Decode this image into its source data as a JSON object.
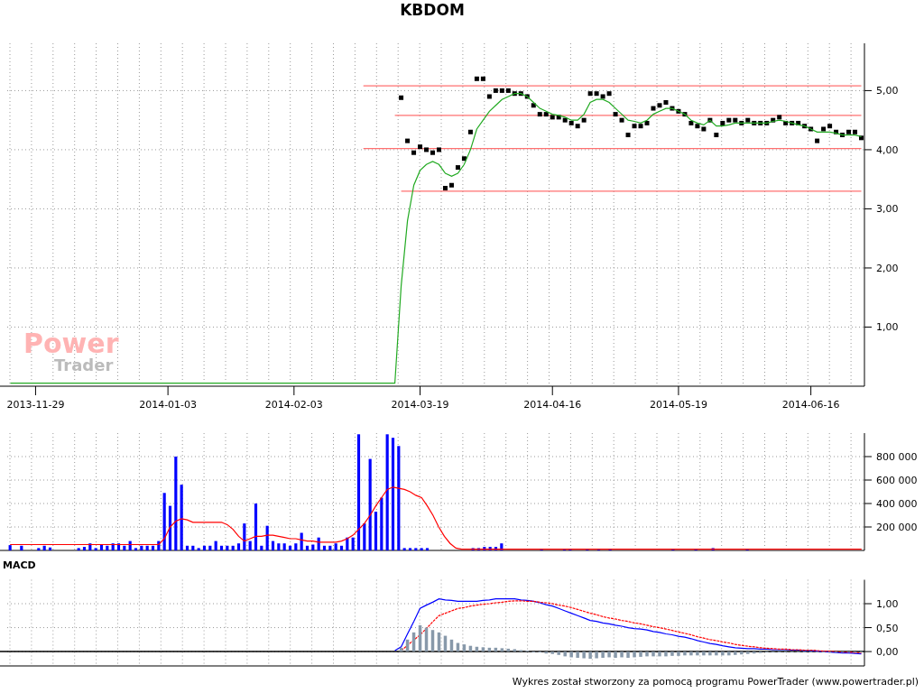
{
  "title": "KBDOM",
  "watermark_logo": {
    "line1": "Power",
    "line2": "Trader"
  },
  "price_chart": {
    "chart_data": {
      "type": "line",
      "grid": true,
      "ylim": [
        0,
        5.8
      ],
      "categories": [
        null,
        null,
        null,
        null,
        "2013-11-29",
        null,
        null,
        null,
        null,
        null,
        null,
        null,
        null,
        null,
        null,
        null,
        null,
        null,
        null,
        null,
        null,
        null,
        null,
        null,
        null,
        "2014-01-03",
        null,
        null,
        null,
        null,
        null,
        null,
        null,
        null,
        null,
        null,
        null,
        null,
        null,
        null,
        null,
        null,
        null,
        null,
        null,
        "2014-02-03",
        null,
        null,
        null,
        null,
        null,
        null,
        null,
        null,
        null,
        null,
        null,
        null,
        null,
        null,
        null,
        null,
        null,
        null,
        null,
        "2014-03-19",
        null,
        null,
        null,
        null,
        null,
        null,
        null,
        null,
        null,
        null,
        null,
        null,
        null,
        null,
        null,
        null,
        null,
        null,
        null,
        null,
        "2014-04-16",
        null,
        null,
        null,
        null,
        null,
        null,
        null,
        null,
        null,
        null,
        null,
        null,
        null,
        null,
        null,
        null,
        null,
        null,
        null,
        "2014-05-19",
        null,
        null,
        null,
        null,
        null,
        null,
        null,
        null,
        null,
        null,
        null,
        null,
        null,
        null,
        null,
        null,
        null,
        null,
        null,
        null,
        "2014-06-16",
        null,
        null,
        null,
        null,
        null,
        null,
        null,
        null
      ],
      "yticks": [
        {
          "value": 1,
          "label": "1,00"
        },
        {
          "value": 2,
          "label": "2,00"
        },
        {
          "value": 3,
          "label": "3,00"
        },
        {
          "value": 4,
          "label": "4,00"
        },
        {
          "value": 5,
          "label": "5,00"
        }
      ],
      "series": [
        {
          "color": "#ff7070",
          "values": [
            null,
            null,
            null,
            null,
            null,
            null,
            null,
            null,
            null,
            null,
            null,
            null,
            null,
            null,
            null,
            null,
            null,
            null,
            null,
            null,
            null,
            null,
            null,
            null,
            null,
            null,
            null,
            null,
            null,
            null,
            null,
            null,
            null,
            null,
            null,
            null,
            null,
            null,
            null,
            null,
            null,
            null,
            null,
            null,
            null,
            null,
            null,
            null,
            null,
            null,
            null,
            null,
            null,
            null,
            null,
            null,
            5.08,
            5.08,
            5.08,
            5.08,
            5.08,
            5.08,
            5.08,
            5.08,
            5.08,
            5.08,
            5.08,
            5.08,
            5.08,
            5.08,
            5.08,
            5.08,
            5.08,
            5.08,
            5.08,
            5.08,
            5.08,
            5.08,
            5.08,
            5.08,
            5.08,
            5.08,
            5.08,
            5.08,
            5.08,
            5.08,
            5.08,
            5.08,
            5.08,
            5.08,
            5.08,
            5.08,
            5.08,
            5.08,
            5.08,
            5.08,
            5.08,
            5.08,
            5.08,
            5.08,
            5.08,
            5.08,
            5.08,
            5.08,
            5.08,
            5.08,
            5.08,
            5.08,
            5.08,
            5.08,
            5.08,
            5.08,
            5.08,
            5.08,
            5.08,
            5.08,
            5.08,
            5.08,
            5.08,
            5.08,
            5.08,
            5.08,
            5.08,
            5.08,
            5.08,
            5.08,
            5.08,
            5.08,
            5.08,
            5.08,
            5.08,
            5.08,
            5.08,
            5.08,
            5.08,
            5.08
          ]
        },
        {
          "color": "#ff7070",
          "values": [
            null,
            null,
            null,
            null,
            null,
            null,
            null,
            null,
            null,
            null,
            null,
            null,
            null,
            null,
            null,
            null,
            null,
            null,
            null,
            null,
            null,
            null,
            null,
            null,
            null,
            null,
            null,
            null,
            null,
            null,
            null,
            null,
            null,
            null,
            null,
            null,
            null,
            null,
            null,
            null,
            null,
            null,
            null,
            null,
            null,
            null,
            null,
            null,
            null,
            null,
            null,
            null,
            null,
            null,
            null,
            null,
            null,
            null,
            null,
            null,
            null,
            4.58,
            4.58,
            4.58,
            4.58,
            4.58,
            4.58,
            4.58,
            4.58,
            4.58,
            4.58,
            4.58,
            4.58,
            4.58,
            4.58,
            4.58,
            4.58,
            4.58,
            4.58,
            4.58,
            4.58,
            4.58,
            4.58,
            4.58,
            4.58,
            4.58,
            4.58,
            4.58,
            4.58,
            4.58,
            4.58,
            4.58,
            4.58,
            4.58,
            4.58,
            4.58,
            4.58,
            4.58,
            4.58,
            4.58,
            4.58,
            4.58,
            4.58,
            4.58,
            4.58,
            4.58,
            4.58,
            4.58,
            4.58,
            4.58,
            4.58,
            4.58,
            4.58,
            4.58,
            4.58,
            4.58,
            4.58,
            4.58,
            4.58,
            4.58,
            4.58,
            4.58,
            4.58,
            4.58,
            4.58,
            4.58,
            4.58,
            4.58,
            4.58,
            4.58,
            4.58,
            4.58,
            4.58,
            4.58,
            4.58,
            4.58
          ]
        },
        {
          "color": "#ff7070",
          "values": [
            null,
            null,
            null,
            null,
            null,
            null,
            null,
            null,
            null,
            null,
            null,
            null,
            null,
            null,
            null,
            null,
            null,
            null,
            null,
            null,
            null,
            null,
            null,
            null,
            null,
            null,
            null,
            null,
            null,
            null,
            null,
            null,
            null,
            null,
            null,
            null,
            null,
            null,
            null,
            null,
            null,
            null,
            null,
            null,
            null,
            null,
            null,
            null,
            null,
            null,
            null,
            null,
            null,
            null,
            null,
            null,
            4.02,
            4.02,
            4.02,
            4.02,
            4.02,
            4.02,
            4.02,
            4.02,
            4.02,
            4.02,
            4.02,
            4.02,
            4.02,
            4.02,
            4.02,
            4.02,
            4.02,
            4.02,
            4.02,
            4.02,
            4.02,
            4.02,
            4.02,
            4.02,
            4.02,
            4.02,
            4.02,
            4.02,
            4.02,
            4.02,
            4.02,
            4.02,
            4.02,
            4.02,
            4.02,
            4.02,
            4.02,
            4.02,
            4.02,
            4.02,
            4.02,
            4.02,
            4.02,
            4.02,
            4.02,
            4.02,
            4.02,
            4.02,
            4.02,
            4.02,
            4.02,
            4.02,
            4.02,
            4.02,
            4.02,
            4.02,
            4.02,
            4.02,
            4.02,
            4.02,
            4.02,
            4.02,
            4.02,
            4.02,
            4.02,
            4.02,
            4.02,
            4.02,
            4.02,
            4.02,
            4.02,
            4.02,
            4.02,
            4.02,
            4.02,
            4.02,
            4.02,
            4.02,
            4.02,
            4.02
          ]
        },
        {
          "color": "#ff7070",
          "values": [
            null,
            null,
            null,
            null,
            null,
            null,
            null,
            null,
            null,
            null,
            null,
            null,
            null,
            null,
            null,
            null,
            null,
            null,
            null,
            null,
            null,
            null,
            null,
            null,
            null,
            null,
            null,
            null,
            null,
            null,
            null,
            null,
            null,
            null,
            null,
            null,
            null,
            null,
            null,
            null,
            null,
            null,
            null,
            null,
            null,
            null,
            null,
            null,
            null,
            null,
            null,
            null,
            null,
            null,
            null,
            null,
            null,
            null,
            null,
            null,
            null,
            null,
            3.3,
            3.3,
            3.3,
            3.3,
            3.3,
            3.3,
            3.3,
            3.3,
            3.3,
            3.3,
            3.3,
            3.3,
            3.3,
            3.3,
            3.3,
            3.3,
            3.3,
            3.3,
            3.3,
            3.3,
            3.3,
            3.3,
            3.3,
            3.3,
            3.3,
            3.3,
            3.3,
            3.3,
            3.3,
            3.3,
            3.3,
            3.3,
            3.3,
            3.3,
            3.3,
            3.3,
            3.3,
            3.3,
            3.3,
            3.3,
            3.3,
            3.3,
            3.3,
            3.3,
            3.3,
            3.3,
            3.3,
            3.3,
            3.3,
            3.3,
            3.3,
            3.3,
            3.3,
            3.3,
            3.3,
            3.3,
            3.3,
            3.3,
            3.3,
            3.3,
            3.3,
            3.3,
            3.3,
            3.3,
            3.3,
            3.3,
            3.3,
            3.3,
            3.3,
            3.3,
            3.3,
            3.3,
            3.3,
            3.3
          ]
        },
        {
          "type": "scatter",
          "color": "#000000",
          "values": [
            null,
            null,
            null,
            null,
            null,
            null,
            null,
            null,
            null,
            null,
            null,
            null,
            null,
            null,
            null,
            null,
            null,
            null,
            null,
            null,
            null,
            null,
            null,
            null,
            null,
            null,
            null,
            null,
            null,
            null,
            null,
            null,
            null,
            null,
            null,
            null,
            null,
            null,
            null,
            null,
            null,
            null,
            null,
            null,
            null,
            null,
            null,
            null,
            null,
            null,
            null,
            null,
            null,
            null,
            null,
            null,
            null,
            null,
            null,
            null,
            null,
            null,
            4.88,
            4.15,
            3.95,
            4.05,
            4.0,
            3.95,
            4.0,
            3.35,
            3.4,
            3.7,
            3.85,
            4.3,
            5.2,
            5.2,
            4.9,
            5.0,
            5.0,
            5.0,
            4.95,
            4.95,
            4.9,
            4.75,
            4.6,
            4.6,
            4.55,
            4.55,
            4.5,
            4.45,
            4.4,
            4.5,
            4.95,
            4.95,
            4.9,
            4.95,
            4.6,
            4.5,
            4.25,
            4.4,
            4.4,
            4.45,
            4.7,
            4.75,
            4.8,
            4.7,
            4.65,
            4.6,
            4.45,
            4.4,
            4.35,
            4.5,
            4.25,
            4.45,
            4.5,
            4.5,
            4.45,
            4.5,
            4.45,
            4.45,
            4.45,
            4.5,
            4.55,
            4.45,
            4.45,
            4.45,
            4.4,
            4.35,
            4.15,
            4.35,
            4.4,
            4.3,
            4.25,
            4.3,
            4.3,
            4.2
          ]
        },
        {
          "color": "#22aa22",
          "values": [
            0.05,
            0.05,
            0.05,
            0.05,
            0.05,
            0.05,
            0.05,
            0.05,
            0.05,
            0.05,
            0.05,
            0.05,
            0.05,
            0.05,
            0.05,
            0.05,
            0.05,
            0.05,
            0.05,
            0.05,
            0.05,
            0.05,
            0.05,
            0.05,
            0.05,
            0.05,
            0.05,
            0.05,
            0.05,
            0.05,
            0.05,
            0.05,
            0.05,
            0.05,
            0.05,
            0.05,
            0.05,
            0.05,
            0.05,
            0.05,
            0.05,
            0.05,
            0.05,
            0.05,
            0.05,
            0.05,
            0.05,
            0.05,
            0.05,
            0.05,
            0.05,
            0.05,
            0.05,
            0.05,
            0.05,
            0.05,
            0.05,
            0.05,
            0.05,
            0.05,
            0.05,
            0.05,
            1.7,
            2.8,
            3.4,
            3.65,
            3.75,
            3.8,
            3.75,
            3.6,
            3.55,
            3.6,
            3.75,
            4.0,
            4.35,
            4.5,
            4.65,
            4.75,
            4.85,
            4.9,
            4.95,
            4.95,
            4.9,
            4.8,
            4.7,
            4.65,
            4.6,
            4.58,
            4.55,
            4.5,
            4.5,
            4.6,
            4.8,
            4.85,
            4.85,
            4.8,
            4.7,
            4.6,
            4.5,
            4.48,
            4.45,
            4.5,
            4.6,
            4.65,
            4.7,
            4.7,
            4.65,
            4.6,
            4.5,
            4.45,
            4.42,
            4.5,
            4.4,
            4.4,
            4.42,
            4.45,
            4.45,
            4.45,
            4.45,
            4.45,
            4.45,
            4.48,
            4.5,
            4.48,
            4.45,
            4.42,
            4.4,
            4.35,
            4.3,
            4.3,
            4.3,
            4.28,
            4.25,
            4.25,
            4.25,
            4.22
          ]
        }
      ]
    }
  },
  "volume_chart": {
    "chart_data": {
      "type": "bar",
      "grid": true,
      "stacked": false,
      "ylim": [
        0,
        1000000
      ],
      "categories": [
        null,
        null,
        null,
        null,
        null,
        null,
        null,
        null,
        null,
        null,
        null,
        null,
        null,
        null,
        null,
        null,
        null,
        null,
        null,
        null,
        null,
        null,
        null,
        null,
        null,
        null,
        null,
        null,
        null,
        null,
        null,
        null,
        null,
        null,
        null,
        null,
        null,
        null,
        null,
        null,
        null,
        null,
        null,
        null,
        null,
        null,
        null,
        null,
        null,
        null,
        null,
        null,
        null,
        null,
        null,
        null,
        null,
        null,
        null,
        null,
        null,
        null,
        null,
        null,
        null,
        null,
        null,
        null,
        null,
        null,
        null,
        null,
        null,
        null,
        null,
        null,
        null,
        null,
        null,
        null,
        null,
        null,
        null,
        null,
        null,
        null,
        null,
        null,
        null,
        null,
        null,
        null,
        null,
        null,
        null,
        null,
        null,
        null,
        null,
        null,
        null,
        null,
        null,
        null,
        null,
        null,
        null,
        null,
        null,
        null,
        null,
        null,
        null,
        null,
        null,
        null,
        null,
        null,
        null,
        null,
        null,
        null,
        null,
        null,
        null,
        null,
        null,
        null,
        null,
        null,
        null,
        null,
        null,
        null,
        null,
        null,
        null,
        null,
        null,
        null,
        null,
        null,
        null,
        null,
        null,
        null,
        null,
        null,
        null,
        null
      ],
      "yticks": [
        {
          "value": 200000,
          "label": "200 000"
        },
        {
          "value": 400000,
          "label": "400 000"
        },
        {
          "value": 600000,
          "label": "600 000"
        },
        {
          "value": 800000,
          "label": "800 000"
        }
      ],
      "series": [
        {
          "color": "#0000ff",
          "values": [
            45000,
            null,
            40000,
            null,
            null,
            20000,
            40000,
            25000,
            null,
            null,
            null,
            null,
            20000,
            30000,
            60000,
            20000,
            50000,
            40000,
            60000,
            60000,
            40000,
            80000,
            20000,
            40000,
            40000,
            40000,
            80000,
            490000,
            380000,
            800000,
            560000,
            40000,
            40000,
            20000,
            40000,
            40000,
            80000,
            40000,
            40000,
            40000,
            60000,
            230000,
            80000,
            400000,
            40000,
            210000,
            80000,
            60000,
            60000,
            40000,
            60000,
            150000,
            40000,
            50000,
            110000,
            40000,
            40000,
            60000,
            40000,
            110000,
            110000,
            990000,
            230000,
            780000,
            330000,
            450000,
            990000,
            960000,
            890000,
            20000,
            20000,
            20000,
            20000,
            20000,
            null,
            null,
            null,
            null,
            null,
            null,
            null,
            20000,
            20000,
            30000,
            30000,
            30000,
            60000,
            null,
            null,
            null,
            null,
            null,
            null,
            10000,
            null,
            null,
            null,
            10000,
            10000,
            null,
            null,
            10000,
            null,
            10000,
            null,
            10000,
            null,
            null,
            null,
            null,
            null,
            null,
            null,
            null,
            null,
            null,
            10000,
            null,
            null,
            null,
            10000,
            null,
            null,
            20000,
            null,
            null,
            null,
            null,
            null,
            10000,
            null,
            null,
            null,
            null,
            null,
            null,
            null,
            null,
            null,
            null,
            null,
            null,
            null,
            null,
            null,
            null,
            null,
            null,
            null,
            null
          ]
        },
        {
          "type": "line",
          "color": "#ff0000",
          "values": [
            50000,
            50000,
            50000,
            50000,
            50000,
            50000,
            50000,
            50000,
            50000,
            50000,
            50000,
            50000,
            50000,
            50000,
            50000,
            50000,
            50000,
            50000,
            50000,
            50000,
            50000,
            50000,
            50000,
            50000,
            50000,
            50000,
            50000,
            100000,
            200000,
            250000,
            270000,
            260000,
            240000,
            240000,
            240000,
            240000,
            240000,
            240000,
            220000,
            180000,
            120000,
            80000,
            100000,
            120000,
            120000,
            130000,
            130000,
            120000,
            110000,
            100000,
            100000,
            90000,
            80000,
            80000,
            70000,
            70000,
            70000,
            70000,
            80000,
            100000,
            130000,
            180000,
            230000,
            300000,
            380000,
            450000,
            520000,
            540000,
            530000,
            520000,
            500000,
            470000,
            450000,
            380000,
            300000,
            200000,
            120000,
            60000,
            20000,
            10000,
            10000,
            10000,
            10000,
            10000,
            10000,
            10000,
            10000,
            10000,
            10000,
            10000,
            10000,
            10000,
            10000,
            10000,
            10000,
            10000,
            10000,
            10000,
            10000,
            10000,
            10000,
            10000,
            10000,
            10000,
            10000,
            10000,
            10000,
            10000,
            10000,
            10000,
            10000,
            10000,
            10000,
            10000,
            10000,
            10000,
            10000,
            10000,
            10000,
            10000,
            10000,
            10000,
            10000,
            10000,
            10000,
            10000,
            10000,
            10000,
            10000,
            10000,
            10000,
            10000,
            10000,
            10000,
            10000,
            10000,
            10000,
            10000,
            10000,
            10000,
            10000,
            10000,
            10000,
            10000,
            10000,
            10000,
            10000,
            10000,
            10000,
            10000
          ]
        }
      ]
    }
  },
  "macd_chart": {
    "label": "MACD",
    "chart_data": {
      "type": "line",
      "grid": true,
      "ylim": [
        -0.3,
        1.5
      ],
      "categories": [
        null,
        null,
        null,
        null,
        null,
        null,
        null,
        null,
        null,
        null,
        null,
        null,
        null,
        null,
        null,
        null,
        null,
        null,
        null,
        null,
        null,
        null,
        null,
        null,
        null,
        null,
        null,
        null,
        null,
        null,
        null,
        null,
        null,
        null,
        null,
        null,
        null,
        null,
        null,
        null,
        null,
        null,
        null,
        null,
        null,
        null,
        null,
        null,
        null,
        null,
        null,
        null,
        null,
        null,
        null,
        null,
        null,
        null,
        null,
        null,
        null,
        null,
        null,
        null,
        null,
        null,
        null,
        null,
        null,
        null,
        null,
        null,
        null,
        null,
        null,
        null,
        null,
        null,
        null,
        null,
        null,
        null,
        null,
        null,
        null,
        null,
        null,
        null,
        null,
        null,
        null,
        null,
        null,
        null,
        null,
        null,
        null,
        null,
        null,
        null,
        null,
        null,
        null,
        null,
        null,
        null,
        null,
        null,
        null,
        null,
        null,
        null,
        null,
        null,
        null,
        null,
        null,
        null,
        null,
        null,
        null,
        null,
        null,
        null,
        null,
        null,
        null,
        null,
        null,
        null,
        null,
        null,
        null,
        null,
        null,
        null
      ],
      "yticks": [
        {
          "value": 0,
          "label": "0,00"
        },
        {
          "value": 0.5,
          "label": "0,50"
        },
        {
          "value": 1,
          "label": "1,00"
        }
      ],
      "series": [
        {
          "color": "#0000ff",
          "values": [
            null,
            null,
            null,
            null,
            null,
            null,
            null,
            null,
            null,
            null,
            null,
            null,
            null,
            null,
            null,
            null,
            null,
            null,
            null,
            null,
            null,
            null,
            null,
            null,
            null,
            null,
            null,
            null,
            null,
            null,
            null,
            null,
            null,
            null,
            null,
            null,
            null,
            null,
            null,
            null,
            null,
            null,
            null,
            null,
            null,
            null,
            null,
            null,
            null,
            null,
            null,
            null,
            null,
            null,
            null,
            null,
            null,
            null,
            null,
            null,
            null,
            0.02,
            0.1,
            0.37,
            0.63,
            0.9,
            0.97,
            1.03,
            1.1,
            1.08,
            1.07,
            1.05,
            1.05,
            1.05,
            1.05,
            1.07,
            1.08,
            1.1,
            1.1,
            1.1,
            1.1,
            1.08,
            1.07,
            1.05,
            1.02,
            0.98,
            0.95,
            0.9,
            0.85,
            0.8,
            0.75,
            0.7,
            0.65,
            0.63,
            0.6,
            0.58,
            0.55,
            0.53,
            0.5,
            0.48,
            0.47,
            0.45,
            0.42,
            0.4,
            0.37,
            0.35,
            0.32,
            0.3,
            0.27,
            0.23,
            0.2,
            0.17,
            0.15,
            0.12,
            0.1,
            0.08,
            0.07,
            0.06,
            0.06,
            0.05,
            0.05,
            0.04,
            0.04,
            0.04,
            0.03,
            0.03,
            0.02,
            0.02,
            0.01,
            0,
            -0.01,
            -0.02,
            -0.03,
            -0.03,
            -0.04,
            -0.05
          ]
        },
        {
          "color": "#ff0000",
          "line_style": "dashed",
          "values": [
            null,
            null,
            null,
            null,
            null,
            null,
            null,
            null,
            null,
            null,
            null,
            null,
            null,
            null,
            null,
            null,
            null,
            null,
            null,
            null,
            null,
            null,
            null,
            null,
            null,
            null,
            null,
            null,
            null,
            null,
            null,
            null,
            null,
            null,
            null,
            null,
            null,
            null,
            null,
            null,
            null,
            null,
            null,
            null,
            null,
            null,
            null,
            null,
            null,
            null,
            null,
            null,
            null,
            null,
            null,
            null,
            null,
            null,
            null,
            null,
            null,
            null,
            0.02,
            0.13,
            0.24,
            0.35,
            0.48,
            0.62,
            0.75,
            0.8,
            0.85,
            0.9,
            0.92,
            0.95,
            0.97,
            0.99,
            1.0,
            1.02,
            1.03,
            1.05,
            1.06,
            1.06,
            1.05,
            1.05,
            1.03,
            1.02,
            1.0,
            0.97,
            0.95,
            0.92,
            0.88,
            0.84,
            0.8,
            0.77,
            0.73,
            0.7,
            0.68,
            0.65,
            0.63,
            0.6,
            0.58,
            0.55,
            0.52,
            0.5,
            0.47,
            0.44,
            0.41,
            0.38,
            0.35,
            0.31,
            0.28,
            0.25,
            0.23,
            0.2,
            0.18,
            0.15,
            0.13,
            0.11,
            0.1,
            0.08,
            0.07,
            0.06,
            0.05,
            0.05,
            0.04,
            0.04,
            0.03,
            0.03,
            0.02,
            0.01,
            0.01,
            0,
            -0.01,
            -0.01,
            -0.02,
            -0.03
          ]
        },
        {
          "type": "bar",
          "color": "#8899aa",
          "values": [
            null,
            null,
            null,
            null,
            null,
            null,
            null,
            null,
            null,
            null,
            null,
            null,
            null,
            null,
            null,
            null,
            null,
            null,
            null,
            null,
            null,
            null,
            null,
            null,
            null,
            null,
            null,
            null,
            null,
            null,
            null,
            null,
            null,
            null,
            null,
            null,
            null,
            null,
            null,
            null,
            null,
            null,
            null,
            null,
            null,
            null,
            null,
            null,
            null,
            null,
            null,
            null,
            null,
            null,
            null,
            null,
            null,
            null,
            null,
            null,
            null,
            null,
            0.08,
            0.25,
            0.4,
            0.55,
            0.5,
            0.45,
            0.4,
            0.33,
            0.25,
            0.18,
            0.15,
            0.12,
            0.1,
            0.09,
            0.08,
            0.08,
            0.07,
            0.06,
            0.05,
            0.03,
            0.02,
            0,
            -0.01,
            -0.04,
            -0.05,
            -0.07,
            -0.1,
            -0.12,
            -0.13,
            -0.14,
            -0.15,
            -0.14,
            -0.13,
            -0.12,
            -0.13,
            -0.12,
            -0.13,
            -0.12,
            -0.11,
            -0.1,
            -0.1,
            -0.1,
            -0.1,
            -0.09,
            -0.09,
            -0.08,
            -0.08,
            -0.08,
            -0.08,
            -0.08,
            -0.08,
            -0.08,
            -0.08,
            -0.07,
            -0.06,
            -0.05,
            -0.04,
            -0.03,
            -0.02,
            -0.02,
            -0.01,
            -0.01,
            -0.01,
            -0.01,
            -0.01,
            -0.01,
            -0.01,
            -0.01,
            -0.02,
            -0.02,
            -0.02,
            -0.02,
            -0.02,
            -0.02
          ]
        }
      ]
    }
  },
  "footer": "Wykres został stworzony za pomocą programu PowerTrader (www.powertrader.pl)"
}
